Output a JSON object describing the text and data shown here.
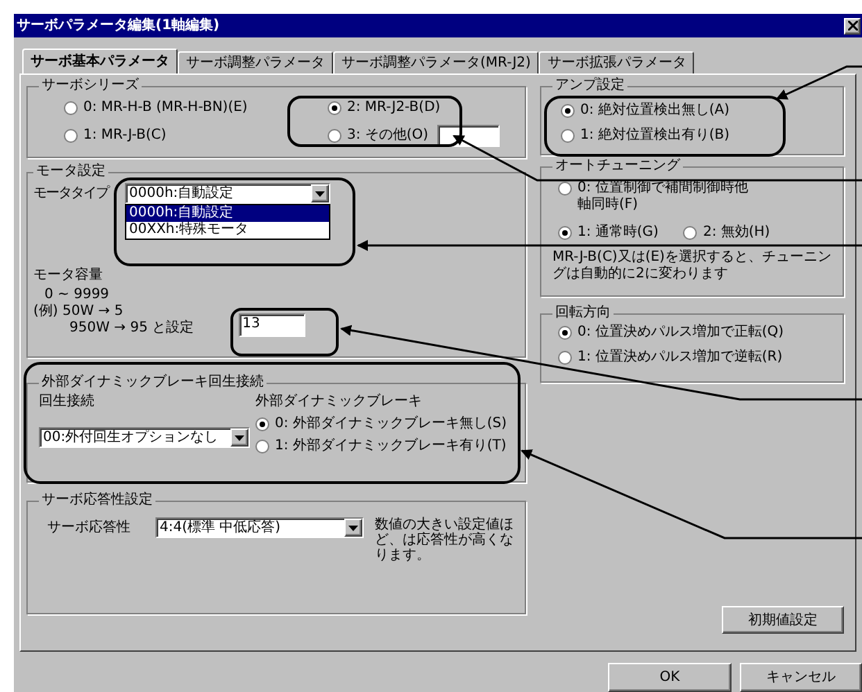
{
  "window": {
    "title": "サーボパラメータ編集(1軸編集)"
  },
  "tabs": [
    {
      "label": "サーボ基本パラメータ",
      "selected": true
    },
    {
      "label": "サーボ調整パラメータ",
      "selected": false
    },
    {
      "label": "サーボ調整パラメータ(MR-J2)",
      "selected": false
    },
    {
      "label": "サーボ拡張パラメータ",
      "selected": false
    }
  ],
  "servo_series": {
    "title": "サーボシリーズ",
    "options": [
      {
        "label": "0: MR-H-B (MR-H-BN)(E)",
        "selected": false
      },
      {
        "label": "2: MR-J2-B(D)",
        "selected": true
      },
      {
        "label": "1: MR-J-B(C)",
        "selected": false
      },
      {
        "label": "3: その他(O)",
        "selected": false
      }
    ]
  },
  "motor_settings": {
    "title": "モータ設定",
    "type_label": "モータタイプ",
    "type_value": "0000h:自動設定",
    "dropdown_items": [
      {
        "label": "0000h:自動設定",
        "selected": true
      },
      {
        "label": "00XXh:特殊モータ",
        "selected": false
      }
    ],
    "capacity_title": "モータ容量",
    "capacity_range": "0 ~ 9999",
    "capacity_example": [
      "(例) 50W → 5",
      "950W → 95 と設定"
    ],
    "capacity_value": "13"
  },
  "external_brake": {
    "title": "外部ダイナミックブレーキ回生接続",
    "regen_label": "回生接続",
    "regen_value": "00:外付回生オプションなし",
    "brake_label": "外部ダイナミックブレーキ",
    "options": [
      {
        "label": "0: 外部ダイナミックブレーキ無し(S)",
        "selected": true
      },
      {
        "label": "1: 外部ダイナミックブレーキ有り(T)",
        "selected": false
      }
    ]
  },
  "response": {
    "title": "サーボ応答性設定",
    "label": "サーボ応答性",
    "value": "4:4(標準 中低応答)",
    "note": "数値の大きい設定値ほど、は応答性が高くなります。"
  },
  "amp": {
    "title": "アンプ設定",
    "options": [
      {
        "label": "0: 絶対位置検出無し(A)",
        "selected": true
      },
      {
        "label": "1: 絶対位置検出有り(B)",
        "selected": false
      }
    ]
  },
  "auto_tuning": {
    "title": "オートチューニング",
    "options": [
      {
        "label": "0: 位置制御で補間制御時他軸同時(F)",
        "selected": false
      },
      {
        "label": "1: 通常時(G)",
        "selected": true
      },
      {
        "label": "2: 無効(H)",
        "selected": false
      }
    ],
    "note": "MR-J-B(C)又は(E)を選択すると、チューニングは自動的に2に変わります"
  },
  "rotation": {
    "title": "回転方向",
    "options": [
      {
        "label": "0: 位置決めパルス増加で正転(Q)",
        "selected": true
      },
      {
        "label": "1: 位置決めパルス増加で逆転(R)",
        "selected": false
      }
    ]
  },
  "buttons": {
    "defaults": "初期値設定",
    "ok": "OK",
    "cancel": "キャンセル"
  }
}
